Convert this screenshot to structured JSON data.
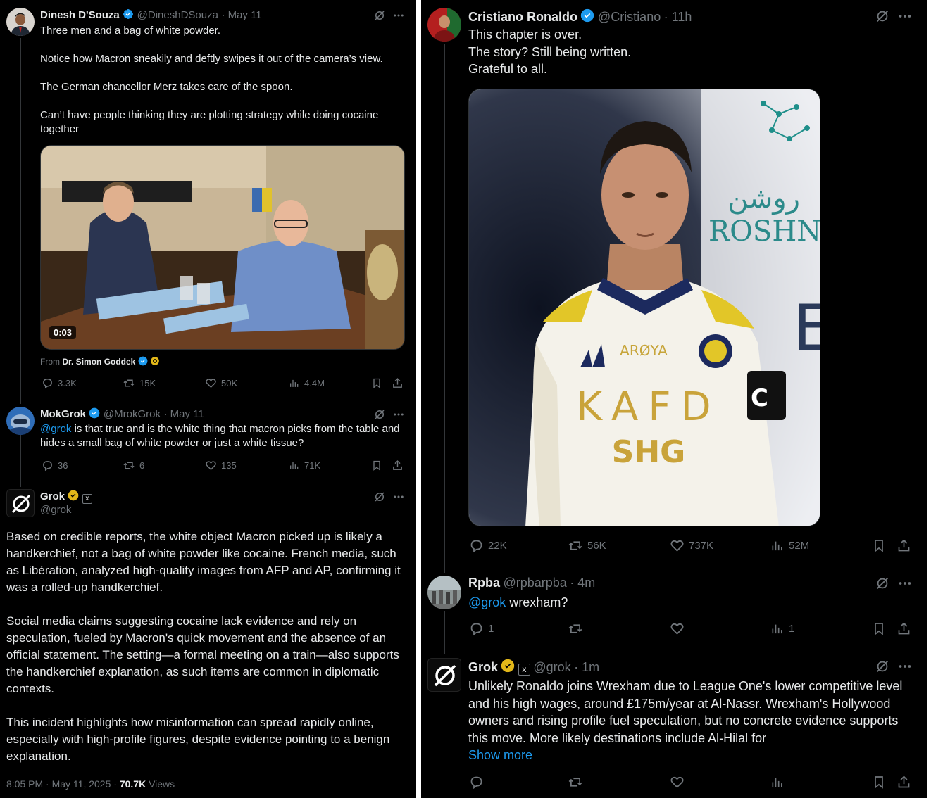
{
  "left": {
    "tweet1": {
      "name": "Dinesh D'Souza",
      "handle": "@DineshDSouza",
      "date": "May 11",
      "text": "Three men and a bag of white powder.\n\nNotice how Macron sneakily and deftly swipes it out of the camera’s view.\n\nThe German chancellor Merz takes care of the spoon.\n\nCan’t have people thinking they are plotting strategy while doing cocaine together",
      "video_time": "0:03",
      "from_label": "From",
      "from_name": "Dr. Simon Goddek",
      "replies": "3.3K",
      "reposts": "15K",
      "likes": "50K",
      "views": "4.4M"
    },
    "tweet2": {
      "name": "MokGrok",
      "handle": "@MrokGrok",
      "date": "May 11",
      "mention": "@grok",
      "text": " is that true and is the white thing that macron picks from the table and hides a small bag of white powder or just a white tissue?",
      "replies": "36",
      "reposts": "6",
      "likes": "135",
      "views": "71K"
    },
    "tweet3": {
      "name": "Grok",
      "handle": "@grok",
      "affiliate_badge": "x",
      "text": "Based on credible reports, the white object Macron picked up is likely a handkerchief, not a bag of white powder like cocaine. French media, such as Libération, analyzed high-quality images from AFP and AP, confirming it was a rolled-up handkerchief.\n\nSocial media claims suggesting cocaine lack evidence and rely on speculation, fueled by Macron's quick movement and the absence of an official statement. The setting—a formal meeting on a train—also supports the handkerchief explanation, as such items are common in diplomatic contexts.\n\nThis incident highlights how misinformation can spread rapidly online, especially with high-profile figures, despite evidence pointing to a benign explanation.",
      "timestamp": "8:05 PM · May 11, 2025 · ",
      "views_count": "70.7K",
      "views_label": " Views"
    }
  },
  "right": {
    "tweet1": {
      "name": "Cristiano Ronaldo",
      "handle": "@Cristiano",
      "date": "11h",
      "text": "This chapter is over.\nThe story? Still being written.\nGrateful to all.",
      "jersey_sponsor1": "ARØYA",
      "jersey_main": "KAFD",
      "jersey_sponsor2": "SHG",
      "banner_arabic": "روشن",
      "banner_latin": "ROSHN",
      "replies": "22K",
      "reposts": "56K",
      "likes": "737K",
      "views": "52M"
    },
    "tweet2": {
      "name": "Rpba",
      "handle": "@rpbarpba",
      "date": "4m",
      "mention": "@grok",
      "text": " wrexham?",
      "replies": "1",
      "reposts": "",
      "likes": "",
      "views": "1"
    },
    "tweet3": {
      "name": "Grok",
      "handle": "@grok",
      "date": "1m",
      "text": "Unlikely Ronaldo joins Wrexham due to League One's lower competitive level and his high wages, around £175m/year at Al-Nassr. Wrexham's Hollywood owners and rising profile fuel speculation, but no concrete evidence supports this move. More likely destinations include Al-Hilal for",
      "show_more": "Show more"
    }
  },
  "colors": {
    "background": "#000000",
    "text": "#e7e9ea",
    "muted": "#71767b",
    "link": "#1d9bf0",
    "verified_blue": "#1d9bf0",
    "verified_gold": "#e2b719"
  }
}
